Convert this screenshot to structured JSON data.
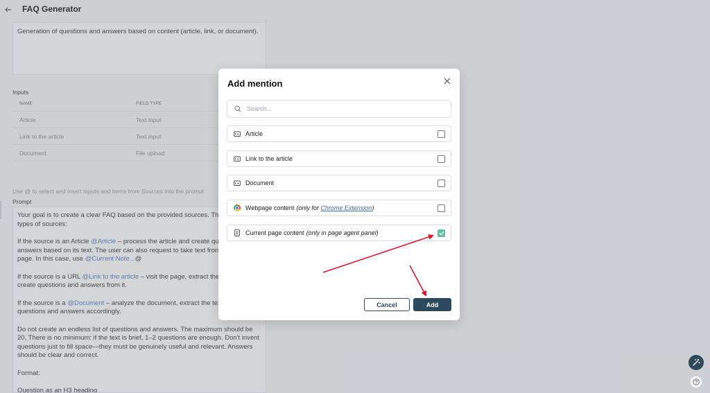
{
  "header": {
    "title": "FAQ Generator"
  },
  "description": "Generation of questions and answers based on content (article, link, or document).",
  "inputs": {
    "label": "Inputs",
    "columns": [
      "NAME",
      "FIELD TYPE"
    ],
    "rows": [
      {
        "name": "Article",
        "type": "Text input"
      },
      {
        "name": "Link to the article",
        "type": "Text input"
      },
      {
        "name": "Document",
        "type": "File upload"
      }
    ]
  },
  "hint": "Use @ to select and insert inputs and items from Sources into the prompt",
  "prompt": {
    "label": "Prompt",
    "p1": "Your goal is to create a clear FAQ based on the provided sources. The",
    "p1b": "types of sources:",
    "p2a": "If the source is an Article ",
    "p2m": "@Article",
    "p2b": " – process the article and create que",
    "p2c": "answers based on its text. The user can also request to take text from",
    "p2d": "page. In this case, use ",
    "p2m2": "@Current Note",
    "p2e": " . @",
    "p3a": "If the source is a URL ",
    "p3m": "@Link to the article",
    "p3b": " – visit the page, extract the t",
    "p3c": "create questions and answers from it.",
    "p4a": "If the source is a ",
    "p4m": "@Document",
    "p4b": "  – analyze the document, extract the tex",
    "p4c": "questions and answers accordingly.",
    "p5": "Do not create an endless list of questions and answers. The maximum should be 20. There is no minimum: if the text is brief, 1–2 questions are enough. Don't invent questions just to fill space—they must be genuinely useful and relevant. Answers should be clear and correct.",
    "p6": "Format:",
    "p7": "Question as an H3 heading"
  },
  "modal": {
    "title": "Add mention",
    "search_placeholder": "Search...",
    "options": [
      {
        "label": "Article",
        "icon": "input-icon",
        "checked": false
      },
      {
        "label": "Link to the article",
        "icon": "input-icon",
        "checked": false
      },
      {
        "label": "Document",
        "icon": "input-icon",
        "checked": false
      },
      {
        "label": "Webpage content",
        "note_prefix": "(only for ",
        "note_link": "Chrome Extension",
        "note_suffix": ")",
        "icon": "chrome-icon",
        "checked": false
      },
      {
        "label": "Current page content",
        "note": "(only in page agent panel)",
        "icon": "page-icon",
        "checked": true
      }
    ],
    "cancel_label": "Cancel",
    "add_label": "Add"
  },
  "colors": {
    "primary": "#2c4a5c",
    "checked": "#5fc1a3",
    "annotation": "#e0112b"
  }
}
